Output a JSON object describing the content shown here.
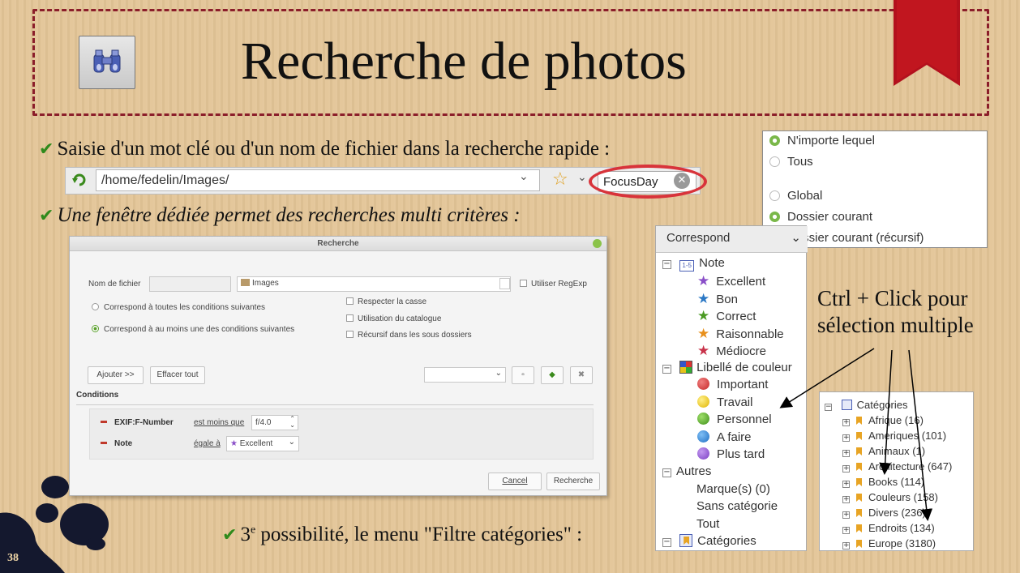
{
  "slide": {
    "title": "Recherche de photos",
    "page_number": "38",
    "bullet1": "Saisie d'un mot clé ou d'un nom de fichier dans la recherche rapide :",
    "bullet2": "Une fenêtre dédiée permet des recherches multi critères :",
    "bullet3_prefix": "3",
    "bullet3_sup": "e",
    "bullet3_rest": " possibilité, le menu \"Filtre  catégories\" :",
    "note_line1": "Ctrl + Click pour",
    "note_line2": "sélection multiple",
    "colors": {
      "frame": "#8b1e2a",
      "ribbon": "#b3111d",
      "check": "#2f8a1c",
      "highlight": "#d8333a"
    }
  },
  "quicksearch": {
    "path": "/home/fedelin/Images/",
    "search_value": "FocusDay"
  },
  "dialog": {
    "title": "Recherche",
    "filename_label": "Nom de fichier",
    "folder_value": "Images",
    "use_regexp": "Utiliser RegExp",
    "radio_all": "Correspond à toutes les conditions suivantes",
    "radio_any": "Correspond à au moins une des conditions suivantes",
    "cb_case": "Respecter la casse",
    "cb_catalog": "Utilisation du catalogue",
    "cb_recursive": "Récursif dans les sous dossiers",
    "add_button": "Ajouter >>",
    "clear_button": "Effacer tout",
    "conditions_label": "Conditions",
    "conditions": [
      {
        "field": "EXIF:F-Number",
        "op": "est moins que",
        "value": "f/4.0"
      },
      {
        "field": "Note",
        "op": "égale à",
        "value": "Excellent"
      }
    ],
    "cancel_button": "Cancel",
    "search_button": "Recherche"
  },
  "radio_popup": {
    "items": [
      "N'importe lequel",
      "Tous",
      "Global",
      "Dossier courant",
      "Dossier courant (récursif)"
    ]
  },
  "filter_tree": {
    "combo": "Correspond",
    "note_group": "Note",
    "ratings": [
      "Excellent",
      "Bon",
      "Correct",
      "Raisonnable",
      "Médiocre"
    ],
    "color_group": "Libellé de couleur",
    "colors": [
      "Important",
      "Travail",
      "Personnel",
      "A faire",
      "Plus tard"
    ],
    "other_group": "Autres",
    "others": [
      "Marque(s) (0)",
      "Sans catégorie",
      "Tout"
    ],
    "categories_group": "Catégories"
  },
  "categories_panel": {
    "root": "Catégories",
    "items": [
      "Afrique (16)",
      "Ameriques (101)",
      "Animaux (1)",
      "Architecture (647)",
      "Books (114)",
      "Couleurs (158)",
      "Divers (236)",
      "Endroits (134)",
      "Europe (3180)"
    ]
  }
}
